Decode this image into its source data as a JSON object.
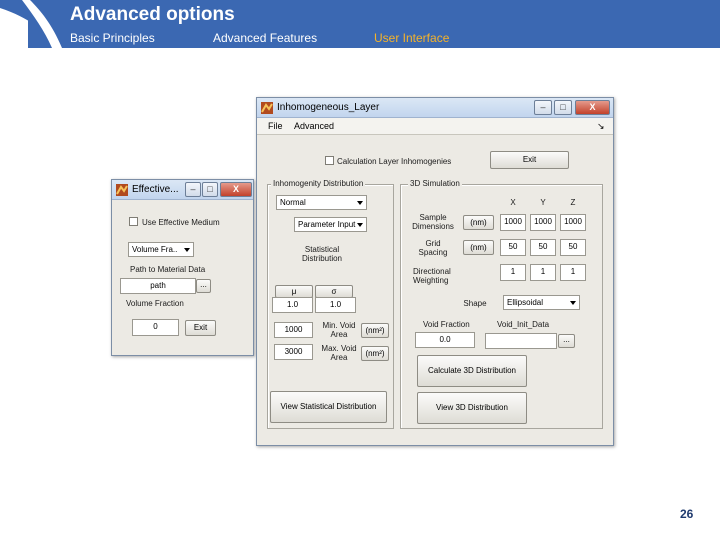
{
  "slide": {
    "title": "Advanced options",
    "nav": [
      "Basic Principles",
      "Advanced Features",
      "User Interface"
    ],
    "page_number": "26",
    "colors": {
      "header": "#3b68b2",
      "active_nav": "#f5b32a"
    }
  },
  "main_window": {
    "title": "Inhomogeneous_Layer",
    "menu": [
      "File",
      "Advanced"
    ],
    "menu_overflow": "↘",
    "calc_checkbox_label": "Calculation Layer Inhomogenies",
    "exit_button": "Exit",
    "inhom_panel": {
      "title": "Inhomogenity Distribution",
      "distribution_select": "Normal",
      "input_select": "Parameter Input",
      "stat_label": "Statistical Distribution",
      "mu_label": "μ",
      "sigma_label": "σ",
      "mu_value": "1.0",
      "sigma_value": "1.0",
      "min_void_value": "1000",
      "min_void_label": "Min. Void Area",
      "max_void_value": "3000",
      "max_void_label": "Max. Void Area",
      "unit_button": "(nm²)",
      "view_stat_button": "View Statistical Distribution"
    },
    "sim_panel": {
      "title": "3D Simulation",
      "axis_headers": [
        "X",
        "Y",
        "Z"
      ],
      "sample_dim_label": "Sample Dimensions",
      "sample_unit": "(nm)",
      "sample_dim": [
        "1000",
        "1000",
        "1000"
      ],
      "grid_label": "Grid Spacing",
      "grid_unit": "(nm)",
      "grid": [
        "50",
        "50",
        "50"
      ],
      "weight_label": "Directional Weighting",
      "weights": [
        "1",
        "1",
        "1"
      ],
      "shape_label": "Shape",
      "shape_select": "Ellipsoidal",
      "void_fraction_label": "Void Fraction",
      "void_fraction_value": "0.0",
      "void_data_label": "Void_Init_Data",
      "void_data_value": "",
      "browse_button": "...",
      "calc_button": "Calculate 3D Distribution",
      "view_button": "View 3D Distribution"
    }
  },
  "eff_window": {
    "title": "Effective...",
    "use_checkbox_label": "Use Effective Medium",
    "volume_select": "Volume Fra..",
    "path_label": "Path to Material Data",
    "path_value": "path",
    "browse_button": "...",
    "volume_label": "Volume Fraction",
    "volume_value": "0",
    "exit_button": "Exit"
  }
}
